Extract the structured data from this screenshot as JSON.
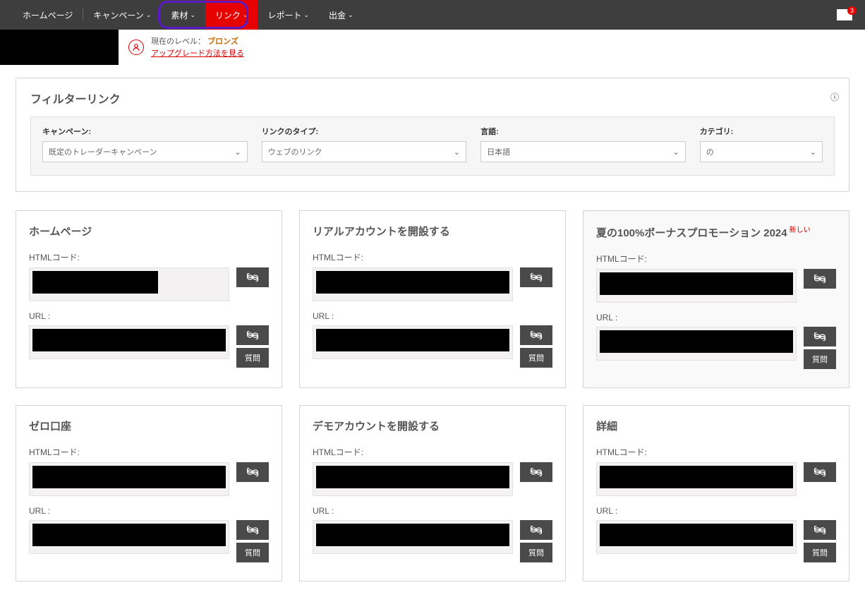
{
  "nav": {
    "items": [
      {
        "label": "ホームページ"
      },
      {
        "label": "キャンペーン"
      },
      {
        "label": "素材"
      },
      {
        "label": "リンク"
      },
      {
        "label": "レポート"
      },
      {
        "label": "出金"
      }
    ],
    "mail_badge": "3"
  },
  "user": {
    "level_prefix": "現在のレベル：",
    "level_value": "ブロンズ",
    "upgrade_link": "アップグレード方法を見る"
  },
  "filter": {
    "title": "フィルターリンク",
    "fields": {
      "campaign": {
        "label": "キャンペーン:",
        "value": "既定のトレーダーキャンペーン"
      },
      "link_type": {
        "label": "リンクのタイプ:",
        "value": "ウェブのリンク"
      },
      "language": {
        "label": "言語:",
        "value": "日本語"
      },
      "category": {
        "label": "カテゴリ:",
        "value": "の"
      }
    }
  },
  "labels": {
    "html_code": "HTMLコード:",
    "url": "URL :",
    "question": "質問"
  },
  "cards": [
    {
      "title": "ホームページ",
      "new": false
    },
    {
      "title": "リアルアカウントを開設する",
      "new": false
    },
    {
      "title": "夏の100%ボーナスプロモーション 2024",
      "new": true
    },
    {
      "title": "ゼロ口座",
      "new": false
    },
    {
      "title": "デモアカウントを開設する",
      "new": false
    },
    {
      "title": "詳細",
      "new": false
    }
  ],
  "new_tag": "新しい"
}
